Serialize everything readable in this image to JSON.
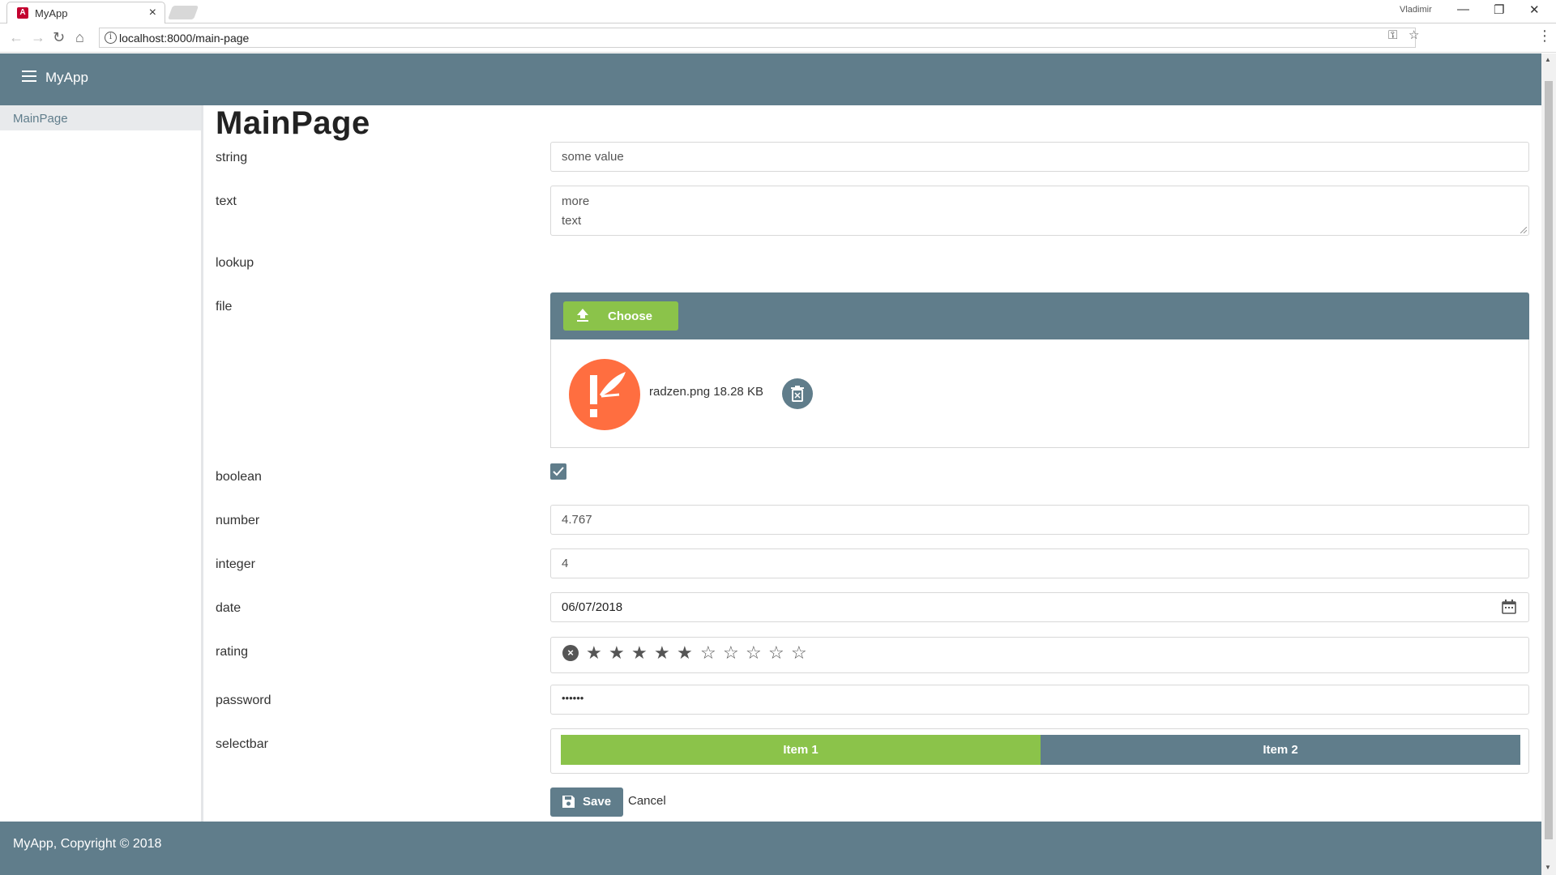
{
  "browser": {
    "tab_title": "MyApp",
    "tab_icon": "A",
    "url": "localhost:8000/main-page",
    "window_user": "Vladimir"
  },
  "app": {
    "title": "MyApp",
    "sidebar": {
      "items": [
        {
          "label": "MainPage",
          "active": true
        }
      ]
    },
    "page_title": "MainPage",
    "footer": "MyApp, Copyright © 2018",
    "colors": {
      "primary": "#607d8b",
      "accent": "#8bc34a",
      "file_thumb": "#ff6e40"
    }
  },
  "form": {
    "string": {
      "label": "string",
      "value": "some value"
    },
    "text": {
      "label": "text",
      "line1": "more",
      "line2": "text"
    },
    "lookup": {
      "label": "lookup"
    },
    "file": {
      "label": "file",
      "choose_label": "Choose",
      "file_name": "radzen.png",
      "file_size": "18.28 KB"
    },
    "boolean": {
      "label": "boolean",
      "checked": true
    },
    "number": {
      "label": "number",
      "value": "4.767"
    },
    "integer": {
      "label": "integer",
      "value": "4"
    },
    "date": {
      "label": "date",
      "value": "06/07/2018"
    },
    "rating": {
      "label": "rating",
      "value": 5,
      "max": 10
    },
    "password": {
      "label": "password",
      "value": "••••••"
    },
    "selectbar": {
      "label": "selectbar",
      "items": [
        "Item 1",
        "Item 2"
      ],
      "selected": "Item 1"
    },
    "save_label": "Save",
    "cancel_label": "Cancel"
  }
}
